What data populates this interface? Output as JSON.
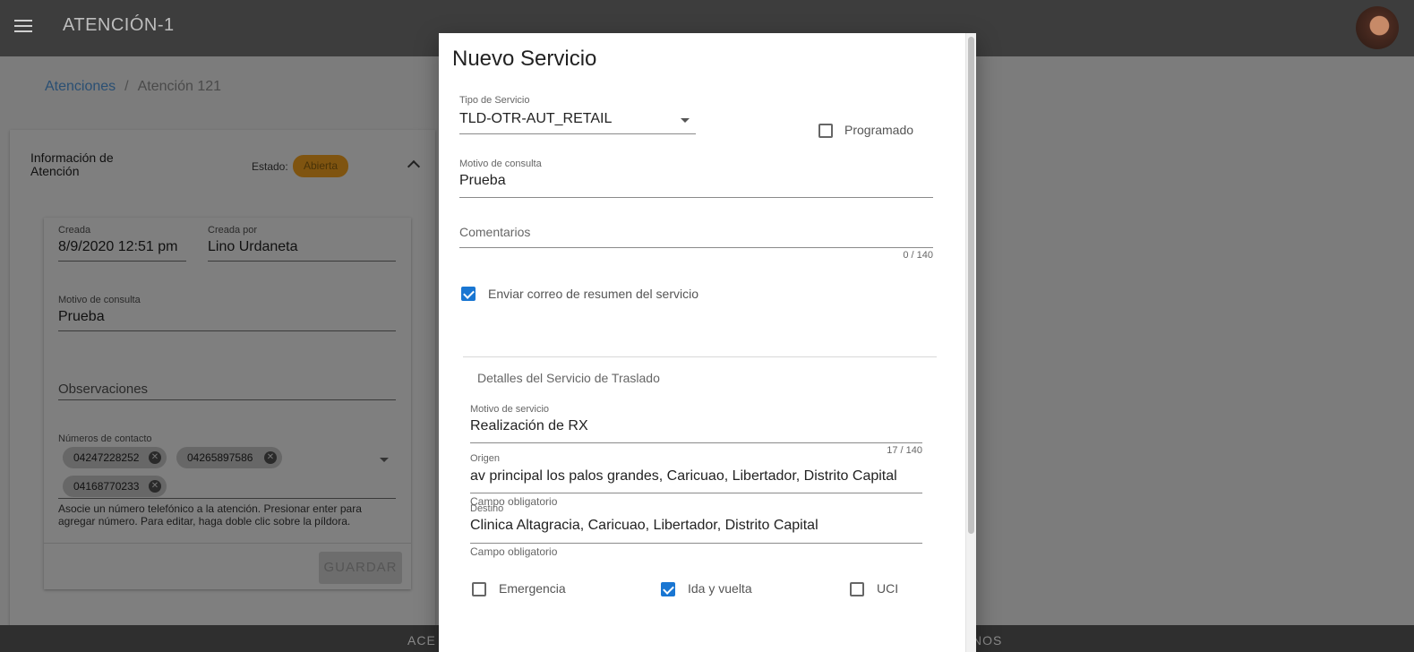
{
  "appbar": {
    "title": "ATENCIÓN-1"
  },
  "breadcrumb": {
    "parent": "Atenciones",
    "separator": "/",
    "current": "Atención 121"
  },
  "info_card": {
    "title": "Información de Atención",
    "estado_label": "Estado:",
    "estado_value": "Abierta",
    "created_label": "Creada",
    "created_value": "8/9/2020 12:51 pm",
    "created_by_label": "Creada por",
    "created_by_value": "Lino Urdaneta",
    "motivo_label": "Motivo de consulta",
    "motivo_value": "Prueba",
    "observaciones_placeholder": "Observaciones",
    "contact_label": "Números de contacto",
    "contact_numbers": [
      "04247228252",
      "04265897586",
      "04168770233"
    ],
    "contact_hint": "Asocie un número telefónico a la atención. Presionar enter para agregar número. Para editar, haga doble clic sobre la píldora.",
    "save_button": "GUARDAR"
  },
  "footer": {
    "left_text": "ACE",
    "right_text": "NOS"
  },
  "dialog": {
    "title": "Nuevo Servicio",
    "tipo_servicio_label": "Tipo de Servicio",
    "tipo_servicio_value": "TLD-OTR-AUT_RETAIL",
    "programado_label": "Programado",
    "programado_checked": false,
    "motivo_label": "Motivo de consulta",
    "motivo_value": "Prueba",
    "comentarios_placeholder": "Comentarios",
    "comentarios_counter": "0 / 140",
    "enviar_correo_label": "Enviar correo de resumen del servicio",
    "enviar_correo_checked": true,
    "section_title": "Detalles del Servicio de Traslado",
    "motivo_servicio_label": "Motivo de servicio",
    "motivo_servicio_value": "Realización de RX",
    "motivo_servicio_counter": "17 / 140",
    "origen_label": "Origen",
    "origen_value": "av principal los palos grandes, Caricuao, Libertador, Distrito Capital",
    "origen_hint": "Campo obligatorio",
    "destino_label": "Destino",
    "destino_value": "Clinica Altagracia, Caricuao, Libertador, Distrito Capital",
    "destino_hint": "Campo obligatorio",
    "emergencia_label": "Emergencia",
    "emergencia_checked": false,
    "ida_vuelta_label": "Ida y vuelta",
    "ida_vuelta_checked": true,
    "uci_label": "UCI",
    "uci_checked": false
  },
  "colors": {
    "accent": "#1976d2",
    "badge": "#7f5410",
    "overlay": "#7a7a7a"
  },
  "icons": [
    "menu-icon",
    "avatar",
    "chevron-up-icon",
    "chip-close-icon",
    "dropdown-arrow-icon",
    "checkbox-icon"
  ]
}
